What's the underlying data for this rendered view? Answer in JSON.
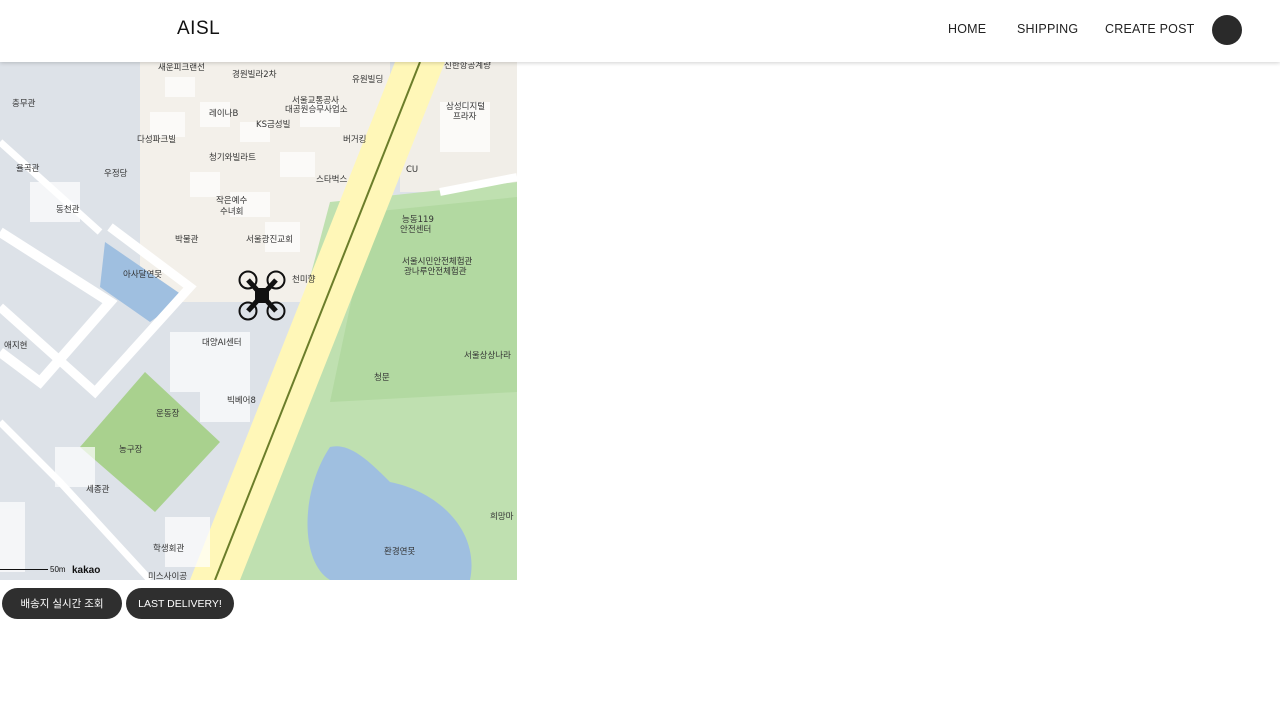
{
  "header": {
    "brand": "AISL",
    "nav": [
      "HOME",
      "SHIPPING",
      "CREATE POST"
    ]
  },
  "map": {
    "labels": [
      "새운피크랜선",
      "경원빌라2차",
      "유원빌딩",
      "신한항공계량",
      "충무관",
      "레이나B",
      "KS금성빌",
      "서울교통공사",
      "대공원승무사업소",
      "삼성디지털",
      "프라자",
      "다성파크빌",
      "버거킹",
      "청기와빌라트",
      "율곡관",
      "우정당",
      "스타벅스",
      "CU",
      "동천관",
      "작은예수",
      "수녀회",
      "능동119",
      "안전센터",
      "박물관",
      "서울광진교회",
      "아사달연못",
      "서울시민안전체험관",
      "광나루안전체험관",
      "천미향",
      "애지현",
      "대양AI센터",
      "서울상상나라",
      "청문",
      "빅베어8",
      "운동장",
      "농구장",
      "세종관",
      "희망마",
      "학생회관",
      "환경연못",
      "미스사이공"
    ],
    "scale_label": "50m",
    "attribution": "kakao",
    "marker": "drone-icon"
  },
  "actions": {
    "realtime_label": "배송지 실시간 조회",
    "last_delivery_label": "LAST DELIVERY!"
  },
  "colors": {
    "button_bg": "#2f2f2f",
    "park": "#a9d18e",
    "road": "#fff9c4",
    "water": "#9fbfe0"
  }
}
